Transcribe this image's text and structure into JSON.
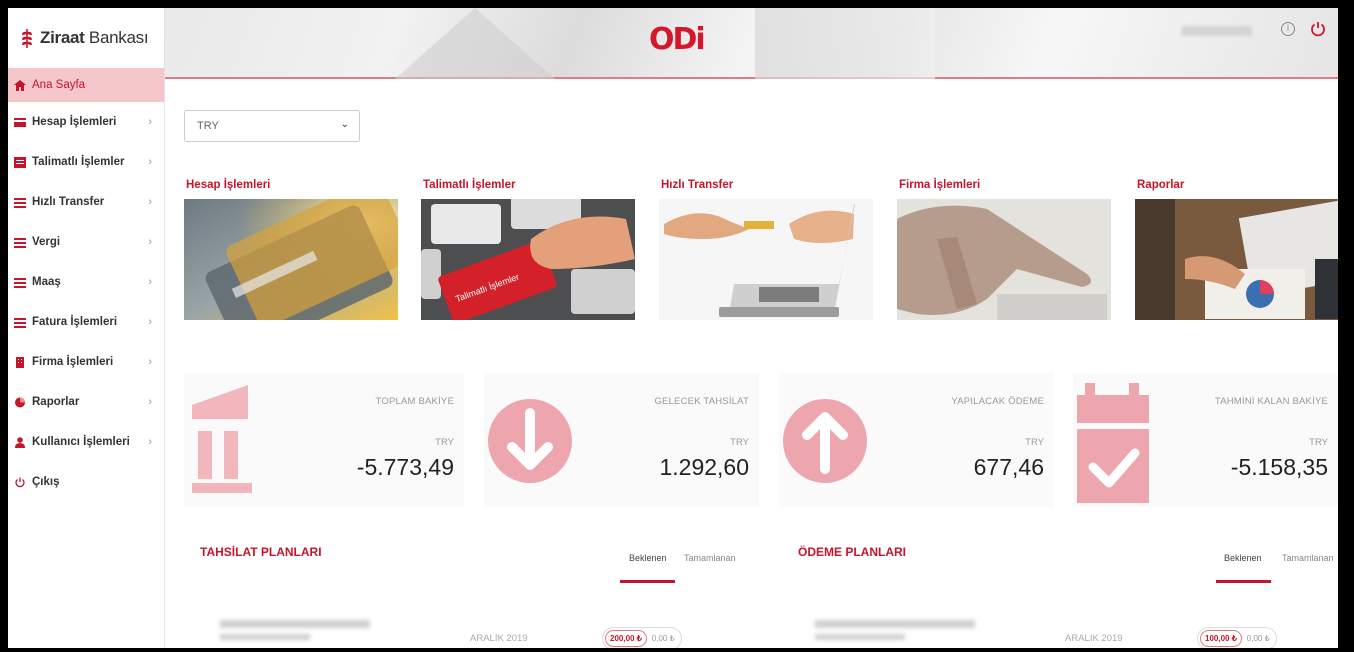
{
  "brand": {
    "name_bold": "Ziraat",
    "name_rest": " Bankası"
  },
  "header": {
    "logo_text": "ODi"
  },
  "sidebar": {
    "items": [
      {
        "label": "Ana Sayfa",
        "icon": "home-icon"
      },
      {
        "label": "Hesap İşlemleri",
        "icon": "card-icon"
      },
      {
        "label": "Talimatlı İşlemler",
        "icon": "list-icon"
      },
      {
        "label": "Hızlı Transfer",
        "icon": "transfer-icon"
      },
      {
        "label": "Vergi",
        "icon": "tax-icon"
      },
      {
        "label": "Maaş",
        "icon": "salary-icon"
      },
      {
        "label": "Fatura İşlemleri",
        "icon": "invoice-icon"
      },
      {
        "label": "Firma İşlemleri",
        "icon": "building-icon"
      },
      {
        "label": "Raporlar",
        "icon": "pie-chart-icon"
      },
      {
        "label": "Kullanıcı İşlemleri",
        "icon": "user-icon"
      },
      {
        "label": "Çıkış",
        "icon": "power-icon"
      }
    ]
  },
  "currency_select": {
    "value": "TRY"
  },
  "cards": [
    {
      "title": "Hesap İşlemleri"
    },
    {
      "title": "Talimatlı İşlemler",
      "image_text": "Talimatlı İşlemler"
    },
    {
      "title": "Hızlı Transfer"
    },
    {
      "title": "Firma İşlemleri"
    },
    {
      "title": "Raporlar"
    }
  ],
  "stats": [
    {
      "label": "TOPLAM BAKİYE",
      "currency": "TRY",
      "value": "-5.773,49",
      "icon": "bank-icon"
    },
    {
      "label": "GELECEK TAHSİLAT",
      "currency": "TRY",
      "value": "1.292,60",
      "icon": "arrow-down-icon"
    },
    {
      "label": "YAPILACAK ÖDEME",
      "currency": "TRY",
      "value": "677,46",
      "icon": "arrow-up-icon"
    },
    {
      "label": "TAHMİNİ KALAN BAKİYE",
      "currency": "TRY",
      "value": "-5.158,35",
      "icon": "calendar-check-icon"
    }
  ],
  "plans": {
    "collection": {
      "title": "TAHSİLAT PLANLARI",
      "tabs": [
        "Beklenen",
        "Tamamlanan"
      ],
      "row": {
        "date": "ARALIK 2019",
        "amount1": "200,00 ₺",
        "amount2": "0,00 ₺"
      }
    },
    "payment": {
      "title": "ÖDEME PLANLARI",
      "tabs": [
        "Beklenen",
        "Tamamlanan"
      ],
      "row": {
        "date": "ARALIK 2019",
        "amount1": "100,00 ₺",
        "amount2": "0,00 ₺"
      }
    }
  },
  "colors": {
    "accent": "#c5152c",
    "accent_light": "#f5c6ca",
    "icon_pink": "#eeaab1"
  }
}
